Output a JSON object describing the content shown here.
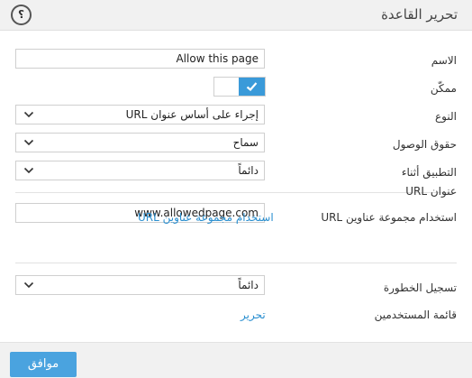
{
  "header": {
    "title": "تحرير القاعدة",
    "help_glyph": "؟"
  },
  "fields": {
    "name_label": "الاسم",
    "name_value": "Allow this page",
    "enabled_label": "ممكّن",
    "enabled": true,
    "type_label": "النوع",
    "type_value": "إجراء على أساس عنوان URL",
    "access_label": "حقوق الوصول",
    "access_value": "سماح",
    "apply_label": "التطبيق أثناء",
    "apply_value": "دائماً",
    "url_label": "عنوان URL",
    "url_value": "www.allowedpage.com",
    "url_group_label": "استخدام مجموعة عناوين URL",
    "url_group_link": "استخدام مجموعة عناوين URL",
    "severity_label": "تسجيل الخطورة",
    "severity_value": "دائماً",
    "users_label": "قائمة المستخدمين",
    "users_link": "تحرير"
  },
  "footer": {
    "ok_label": "موافق"
  },
  "colors": {
    "accent": "#3a9ad9",
    "link": "#2a8fd0",
    "button": "#4aa3df"
  }
}
